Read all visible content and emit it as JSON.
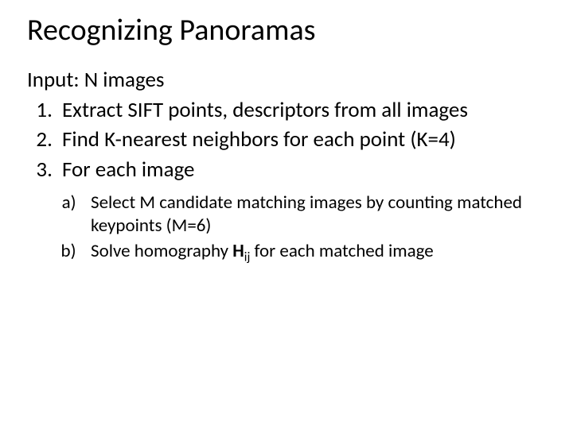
{
  "title": "Recognizing Panoramas",
  "input_line": "Input: N images",
  "steps": {
    "s1": "Extract SIFT points, descriptors from all images",
    "s2": "Find K-nearest neighbors for each point (K=4)",
    "s3": "For each image"
  },
  "substeps": {
    "a": "Select M candidate matching images by counting matched keypoints (M=6)",
    "b_pre": "Solve homography ",
    "b_H": "H",
    "b_ij": "ij",
    "b_post": " for each matched image"
  }
}
